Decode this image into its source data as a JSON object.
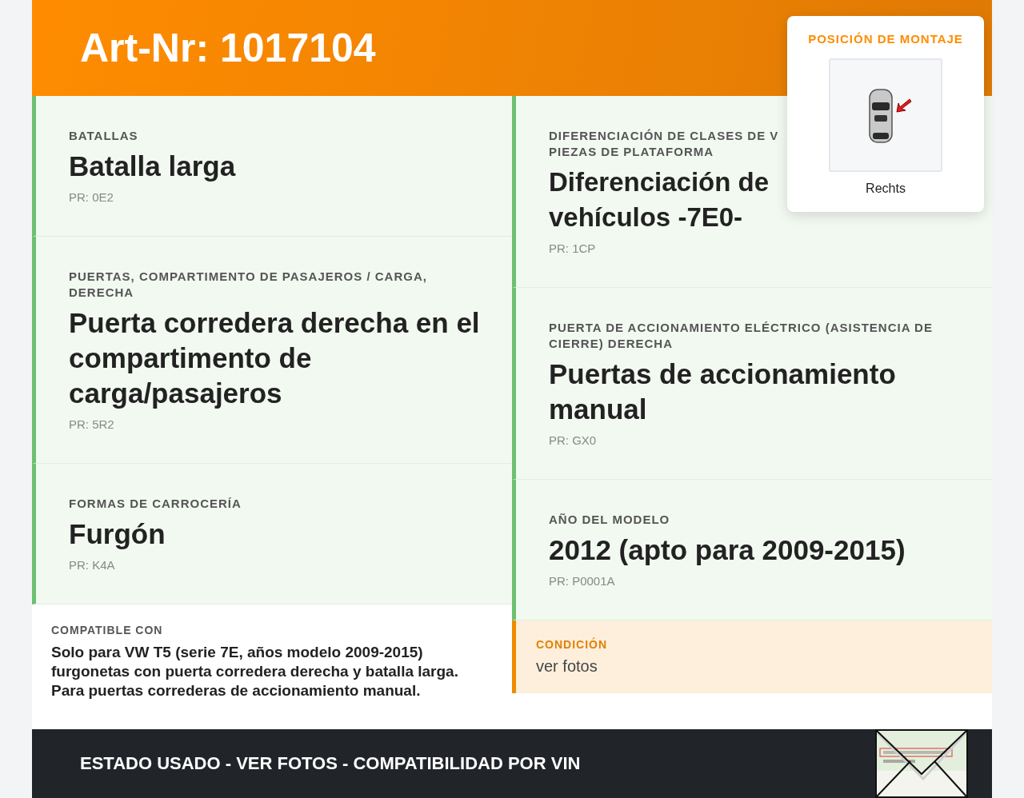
{
  "header": {
    "title": "Art-Nr: 1017104"
  },
  "mounting": {
    "label": "POSICIÓN DE MONTAJE",
    "position": "Rechts"
  },
  "columns": [
    [
      {
        "label": "BATALLAS",
        "value": "Batalla larga",
        "pr": "PR: 0E2"
      },
      {
        "label": "PUERTAS, COMPARTIMENTO DE PASAJEROS / CARGA, DERECHA",
        "value": "Puerta corredera derecha en el compartimento de carga/pasajeros",
        "pr": "PR: 5R2"
      },
      {
        "label": "FORMAS DE CARROCERÍA",
        "value": "Furgón",
        "pr": "PR: K4A"
      }
    ],
    [
      {
        "label": "DIFERENCIACIÓN DE CLASES DE V PIEZAS DE PLATAFORMA",
        "value": "Diferenciación de vehículos -7E0-",
        "pr": "PR: 1CP"
      },
      {
        "label": "PUERTA DE ACCIONAMIENTO ELÉCTRICO (ASISTENCIA DE CIERRE) DERECHA",
        "value": "Puertas de accionamiento manual",
        "pr": "PR: GX0"
      },
      {
        "label": "AÑO DEL MODELO",
        "value": "2012 (apto para 2009-2015)",
        "pr": "PR: P0001A"
      }
    ]
  ],
  "compatible": {
    "label": "COMPATIBLE CON",
    "text": "Solo para VW T5 (serie 7E, años modelo 2009-2015) furgonetas con puerta corredera derecha y batalla larga. Para puertas correderas de accionamiento manual."
  },
  "condition": {
    "label": "CONDICIÓN",
    "value": "ver fotos"
  },
  "footer": {
    "text": "ESTADO USADO - VER FOTOS - COMPATIBILIDAD POR VIN"
  }
}
